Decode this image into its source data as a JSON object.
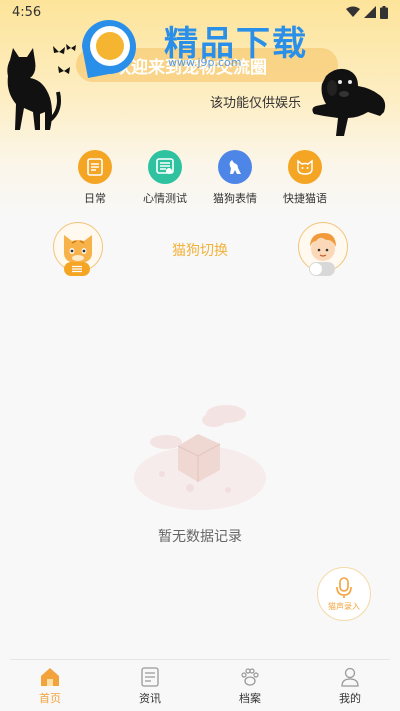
{
  "status_bar": {
    "time": "4:56"
  },
  "banner": {
    "text": "欢迎来到宠物交流圈"
  },
  "watermark": {
    "title": "精品下载",
    "url": "www.j9p.com"
  },
  "notice": "该功能仅供娱乐",
  "features": [
    {
      "label": "日常",
      "icon": "note-icon",
      "color": "#f5a524"
    },
    {
      "label": "心情测试",
      "icon": "mood-test-icon",
      "color": "#2fc2a0"
    },
    {
      "label": "猫狗表情",
      "icon": "dog-sticker-icon",
      "color": "#4e86e8"
    },
    {
      "label": "快捷猫语",
      "icon": "cat-face-icon",
      "color": "#f5a524"
    }
  ],
  "switch": {
    "title": "猫狗切换",
    "cat_selected": true
  },
  "empty_state": {
    "text": "暂无数据记录"
  },
  "record_button": {
    "label": "猫声录入"
  },
  "nav": [
    {
      "label": "首页",
      "icon": "home-icon",
      "active": true
    },
    {
      "label": "资讯",
      "icon": "news-icon",
      "active": false
    },
    {
      "label": "档案",
      "icon": "paw-icon",
      "active": false
    },
    {
      "label": "我的",
      "icon": "user-icon",
      "active": false
    }
  ],
  "colors": {
    "accent": "#f2a33c",
    "primary_yellow": "#f5a524"
  }
}
